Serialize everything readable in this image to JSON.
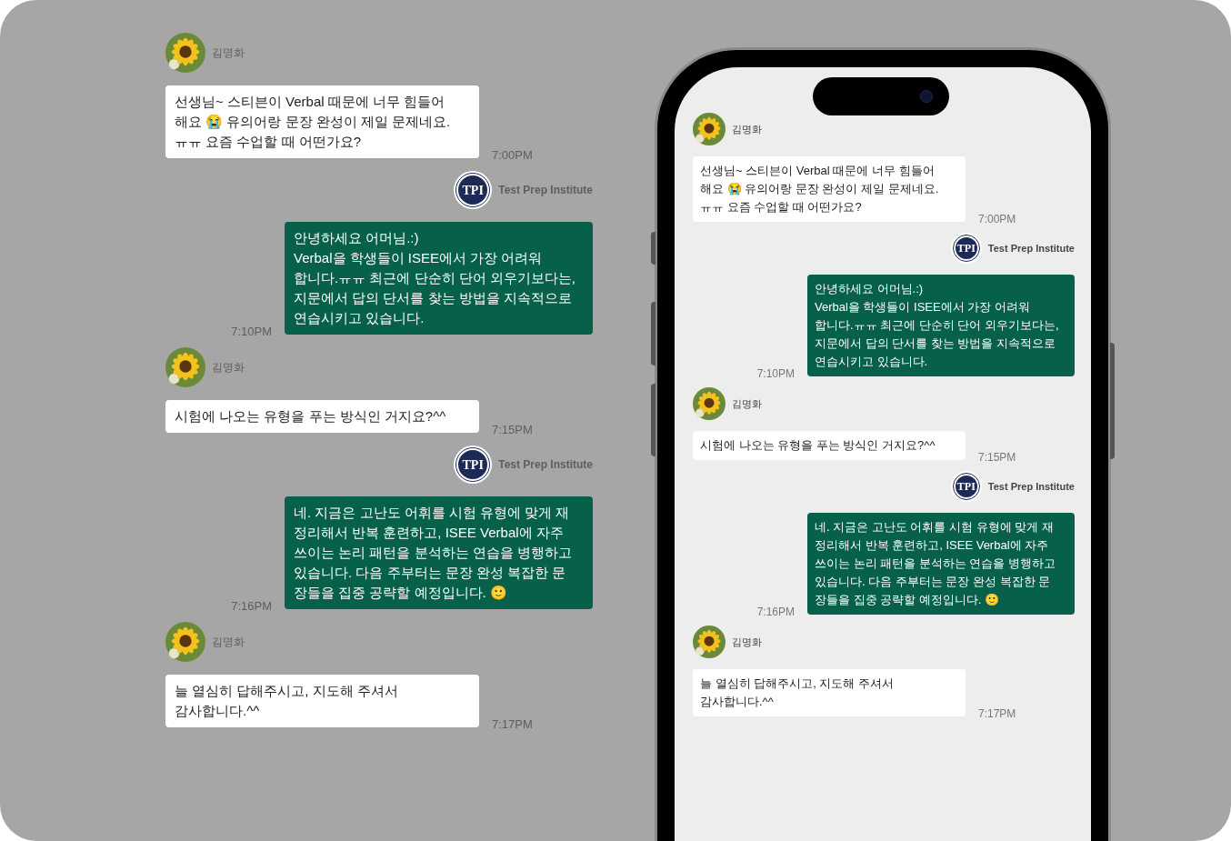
{
  "chat": {
    "messages": [
      {
        "kind": "incoming",
        "sender": "김명화",
        "text": "선생님~ 스티븐이 Verbal 때문에 너무 힘들어\n해요 😭 유의어랑 문장 완성이 제일 문제네요.\nㅠㅠ 요즘 수업할 때 어떤가요?",
        "time": "7:00PM"
      },
      {
        "kind": "outgoing",
        "sender": "Test Prep Institute",
        "logo": "TPI",
        "text": "안녕하세요 어머님.:)\nVerbal을 학생들이 ISEE에서 가장 어려워\n합니다.ㅠㅠ 최근에 단순히 단어 외우기보다는,\n지문에서 답의 단서를 찾는 방법을 지속적으로\n연습시키고 있습니다.",
        "time": "7:10PM"
      },
      {
        "kind": "incoming",
        "sender": "김명화",
        "text": "시험에 나오는 유형을 푸는 방식인 거지요?^^",
        "time": "7:15PM"
      },
      {
        "kind": "outgoing",
        "sender": "Test Prep Institute",
        "logo": "TPI",
        "text": "네. 지금은 고난도 어휘를 시험 유형에 맞게 재\n정리해서 반복 훈련하고, ISEE Verbal에 자주\n쓰이는 논리 패턴을 분석하는 연습을 병행하고\n있습니다. 다음 주부터는 문장 완성 복잡한 문\n장들을 집중 공략할 예정입니다. 🙂",
        "time": "7:16PM"
      },
      {
        "kind": "incoming",
        "sender": "김명화",
        "text": "늘 열심히 답해주시고, 지도해 주셔서\n감사합니다.^^",
        "time": "7:17PM"
      }
    ]
  },
  "phone": {
    "messages": [
      {
        "kind": "incoming",
        "sender": "김명화",
        "text": "선생님~ 스티븐이 Verbal 때문에 너무 힘들어\n해요 😭 유의어랑 문장 완성이 제일 문제네요.\nㅠㅠ 요즘 수업할 때 어떤가요?",
        "time": "7:00PM"
      },
      {
        "kind": "outgoing",
        "sender": "Test Prep Institute",
        "logo": "TPI",
        "text": "안녕하세요 어머님.:)\nVerbal을 학생들이 ISEE에서 가장 어려워\n합니다.ㅠㅠ 최근에 단순히 단어 외우기보다는,\n지문에서 답의 단서를 찾는 방법을 지속적으로\n연습시키고 있습니다.",
        "time": "7:10PM"
      },
      {
        "kind": "incoming",
        "sender": "김명화",
        "text": "시험에 나오는 유형을 푸는 방식인 거지요?^^",
        "time": "7:15PM"
      },
      {
        "kind": "outgoing",
        "sender": "Test Prep Institute",
        "logo": "TPI",
        "text": "네. 지금은 고난도 어휘를 시험 유형에 맞게 재\n정리해서 반복 훈련하고, ISEE Verbal에 자주\n쓰이는 논리 패턴을 분석하는 연습을 병행하고\n있습니다. 다음 주부터는 문장 완성 복잡한 문\n장들을 집중 공략할 예정입니다. 🙂",
        "time": "7:16PM"
      },
      {
        "kind": "incoming",
        "sender": "김명화",
        "text": "늘 열심히 답해주시고, 지도해 주셔서\n감사합니다.^^",
        "time": "7:17PM"
      }
    ]
  }
}
